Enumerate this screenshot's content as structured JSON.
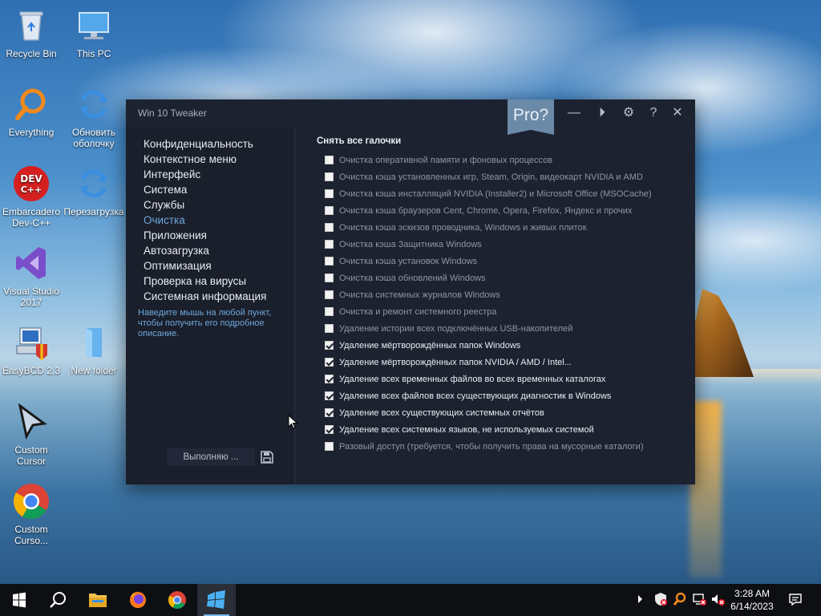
{
  "desktop": {
    "icons": [
      {
        "label": "Recycle Bin"
      },
      {
        "label": "This PC"
      },
      {
        "label": "Everything"
      },
      {
        "label": "Обновить оболочку"
      },
      {
        "label": "Embarcadero Dev-C++"
      },
      {
        "label": "Перезагрузка"
      },
      {
        "label": "Visual Studio 2017"
      },
      {
        "label": "EasyBCD 2.3"
      },
      {
        "label": "New folder"
      },
      {
        "label": "Custom Cursor"
      },
      {
        "label": "Custom Curso..."
      }
    ]
  },
  "window": {
    "title": "Win 10 Tweaker",
    "pro_label": "Pro?",
    "titlebar_icons": [
      "minimize-icon",
      "play-next-icon",
      "gear-icon",
      "help-icon",
      "close-icon"
    ],
    "titlebar_glyphs": {
      "minimize": "—",
      "next": "⏵",
      "settings": "⚙",
      "help": "?",
      "close": "✕"
    },
    "sidebar": {
      "items": [
        {
          "label": "Конфиденциальность",
          "active": false
        },
        {
          "label": "Контекстное меню",
          "active": false
        },
        {
          "label": "Интерфейс",
          "active": false
        },
        {
          "label": "Система",
          "active": false
        },
        {
          "label": "Службы",
          "active": false
        },
        {
          "label": "Очистка",
          "active": true
        },
        {
          "label": "Приложения",
          "active": false
        },
        {
          "label": "Автозагрузка",
          "active": false
        },
        {
          "label": "Оптимизация",
          "active": false
        },
        {
          "label": "Проверка на вирусы",
          "active": false
        },
        {
          "label": "Системная информация",
          "active": false
        }
      ],
      "hint": "Наведите мышь на любой пункт, чтобы получить его подробное описание.",
      "run_button": "Выполняю ...",
      "accent_color": "#6fa8dc"
    },
    "content": {
      "section_title": "Снять все галочки",
      "options": [
        {
          "label": "Очистка оперативной памяти и фоновых процессов",
          "checked": false
        },
        {
          "label": "Очистка кэша установленных игр, Steam, Origin, видеокарт NVIDIA и AMD",
          "checked": false
        },
        {
          "label": "Очистка кэша инсталляций NVIDIA (Installer2) и Microsoft Office (MSOCache)",
          "checked": false
        },
        {
          "label": "Очистка кэша браузеров Cent, Chrome, Opera, Firefox, Яндекс и прочих",
          "checked": false
        },
        {
          "label": "Очистка кэша эскизов проводника, Windows и живых плиток",
          "checked": false
        },
        {
          "label": "Очистка кэша Защитника Windows",
          "checked": false
        },
        {
          "label": "Очистка кэша установок Windows",
          "checked": false
        },
        {
          "label": "Очистка кэша обновлений Windows",
          "checked": false
        },
        {
          "label": "Очистка системных журналов Windows",
          "checked": false
        },
        {
          "label": "Очистка и ремонт системного реестра",
          "checked": false
        },
        {
          "label": "Удаление истории всех подключённых USB-накопителей",
          "checked": false
        },
        {
          "label": "Удаление мёртворождённых папок Windows",
          "checked": true
        },
        {
          "label": "Удаление мёртворождённых папок NVIDIA / AMD / Intel...",
          "checked": true
        },
        {
          "label": "Удаление всех временных файлов во всех временных каталогах",
          "checked": true
        },
        {
          "label": "Удаление всех файлов всех существующих диагностик в Windows",
          "checked": true
        },
        {
          "label": "Удаление всех существующих системных отчётов",
          "checked": true
        },
        {
          "label": "Удаление всех системных языков, не используемых системой",
          "checked": true
        },
        {
          "label": "Разовый доступ (требуется, чтобы получить права на мусорные каталоги)",
          "checked": false
        }
      ]
    }
  },
  "taskbar": {
    "items": [
      "start-icon",
      "search-icon",
      "file-explorer-icon",
      "firefox-icon",
      "chrome-icon",
      "win10tweaker-icon"
    ],
    "tray": [
      "chevron-up-icon",
      "security-icon",
      "everything-icon",
      "network-icon",
      "volume-icon"
    ],
    "clock_time": "3:28 AM",
    "clock_date": "6/14/2023",
    "notification_icon": "notification-icon"
  }
}
